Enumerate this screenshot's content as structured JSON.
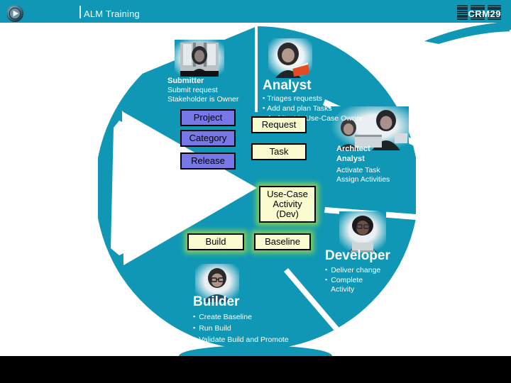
{
  "header": {
    "title": "ALM Training",
    "logo_alt": "IBM"
  },
  "footer": {
    "code": "CRM29",
    "play_icon": "play-circle-icon"
  },
  "roles": {
    "submitter": {
      "name": "Submitter",
      "lines": [
        "Submit request",
        "Stakeholder is Owner"
      ],
      "photo": "submitter-photo"
    },
    "analyst": {
      "name": "Analyst",
      "bullets": [
        "Triages requests",
        "Add and plan Tasks",
        "Architect is Use-Case Owner"
      ],
      "photo": "analyst-photo"
    },
    "architect_analyst": {
      "name_line1": "Architect",
      "name_line2": "Analyst",
      "lines": [
        "Activate Task",
        "Assign Activities"
      ],
      "photo": "architect-analyst-photo"
    },
    "developer": {
      "name": "Developer",
      "bullets": [
        "Deliver change",
        "Complete",
        "Activity"
      ],
      "photo": "developer-photo"
    },
    "builder": {
      "name": "Builder",
      "bullets": [
        "Create Baseline",
        "Run Build",
        "Validate Build and Promote"
      ],
      "photo": "builder-photo"
    }
  },
  "artifacts": {
    "project": "Project",
    "category": "Category",
    "release": "Release",
    "request": "Request",
    "task": "Task",
    "use_case_activity": "Use-Case\nActivity\n(Dev)",
    "use_case_activity_l1": "Use-Case",
    "use_case_activity_l2": "Activity",
    "use_case_activity_l3": "(Dev)",
    "build": "Build",
    "baseline": "Baseline"
  },
  "colors": {
    "teal": "#0f97b5",
    "blue_box": "#7777e8",
    "cream_box": "#fbfbd0",
    "glow": "#96dc46",
    "footer": "#000000",
    "logo": "#10343e"
  }
}
